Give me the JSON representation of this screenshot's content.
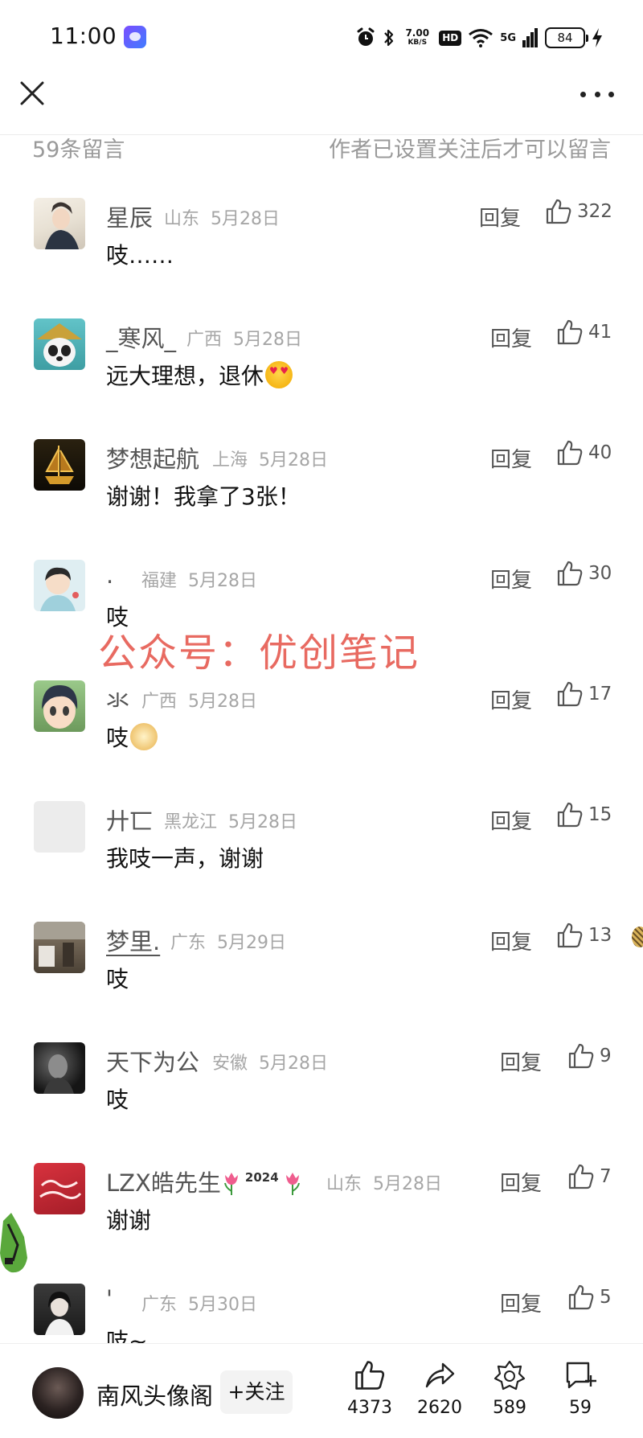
{
  "status_bar": {
    "time": "11:00",
    "net_speed_value": "7.00",
    "net_speed_unit": "KB/S",
    "hd": "HD",
    "signal": "5G",
    "battery": "84"
  },
  "header": {
    "comment_count": "59条留言",
    "comment_rule": "作者已设置关注后才可以留言"
  },
  "comments": [
    {
      "name": "星辰",
      "region": "山东",
      "date": "5月28日",
      "text": "吱……",
      "reply": "回复",
      "likes": "322"
    },
    {
      "name": "_寒风_",
      "region": "广西",
      "date": "5月28日",
      "text": "远大理想，退休",
      "reply": "回复",
      "likes": "41"
    },
    {
      "name": "梦想起航",
      "region": "上海",
      "date": "5月28日",
      "text": "谢谢！我拿了3张！",
      "reply": "回复",
      "likes": "40"
    },
    {
      "name": ".",
      "region": "福建",
      "date": "5月28日",
      "text": "吱",
      "reply": "回复",
      "likes": "30"
    },
    {
      "name": "氺",
      "region": "广西",
      "date": "5月28日",
      "text": "吱",
      "reply": "回复",
      "likes": "17"
    },
    {
      "name": "廾匸",
      "region": "黑龙江",
      "date": "5月28日",
      "text": "我吱一声，谢谢",
      "reply": "回复",
      "likes": "15"
    },
    {
      "name": "梦里.",
      "region": "广东",
      "date": "5月29日",
      "text": "吱",
      "reply": "回复",
      "likes": "13"
    },
    {
      "name": "天下为公",
      "region": "安徽",
      "date": "5月28日",
      "text": "吱",
      "reply": "回复",
      "likes": "9"
    },
    {
      "name": "LZX皓先生",
      "name_tag": "2024",
      "region": "山东",
      "date": "5月28日",
      "text": "谢谢",
      "reply": "回复",
      "likes": "7"
    },
    {
      "name": "'",
      "region": "广东",
      "date": "5月30日",
      "text": "吱~",
      "reply": "回复",
      "likes": "5"
    }
  ],
  "watermark": "公众号：优创笔记",
  "bottom_bar": {
    "author_name": "南风头像阁",
    "follow_label": "+关注",
    "likes": "4373",
    "shares": "2620",
    "favorites": "589",
    "comments": "59"
  },
  "icons": [
    "close-icon",
    "more-icon",
    "thumbs-up-icon",
    "share-icon",
    "favorite-icon",
    "comment-add-icon",
    "alarm-icon",
    "bluetooth-icon",
    "wifi-icon",
    "signal-icon",
    "battery-icon",
    "charging-icon"
  ]
}
